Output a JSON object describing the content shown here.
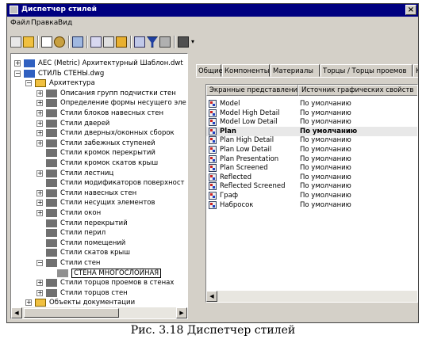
{
  "window": {
    "title": "Диспетчер стилей",
    "close_glyph": "×"
  },
  "menu": [
    "Файл",
    "Правка",
    "Вид"
  ],
  "toolbar_icons": [
    "open-icon",
    "open-folder-icon",
    "copy-icon",
    "paste-icon",
    "properties-icon",
    "purge-icon",
    "edit-icon",
    "paint-icon",
    "sort-icon",
    "filter-icon",
    "toggle-icon",
    "display-icon"
  ],
  "tree": {
    "items": [
      {
        "label": "AEC (Metric) Архитектурный Шаблон.dwt",
        "indent": 0,
        "expander": "+",
        "icon": "drawing-icon"
      },
      {
        "label": "СТИЛЬ СТЕНЫ.dwg",
        "indent": 0,
        "expander": "−",
        "icon": "drawing-icon"
      },
      {
        "label": "Архитектура",
        "indent": 1,
        "expander": "−",
        "icon": "folder-icon"
      },
      {
        "label": "Описания групп подчистки стен",
        "indent": 2,
        "expander": "+",
        "icon": "style-icon"
      },
      {
        "label": "Определение формы несущего эле",
        "indent": 2,
        "expander": "+",
        "icon": "style-icon"
      },
      {
        "label": "Стили блоков навесных стен",
        "indent": 2,
        "expander": "+",
        "icon": "style-icon"
      },
      {
        "label": "Стили дверей",
        "indent": 2,
        "expander": "+",
        "icon": "style-icon"
      },
      {
        "label": "Стили дверных/оконных сборок",
        "indent": 2,
        "expander": "+",
        "icon": "style-icon"
      },
      {
        "label": "Стили забежных ступеней",
        "indent": 2,
        "expander": "+",
        "icon": "style-icon"
      },
      {
        "label": "Стили кромок перекрытий",
        "indent": 2,
        "expander": "",
        "icon": "style-icon"
      },
      {
        "label": "Стили кромок скатов крыш",
        "indent": 2,
        "expander": "",
        "icon": "style-icon"
      },
      {
        "label": "Стили лестниц",
        "indent": 2,
        "expander": "+",
        "icon": "style-icon"
      },
      {
        "label": "Стили модификаторов поверхност",
        "indent": 2,
        "expander": "",
        "icon": "style-icon"
      },
      {
        "label": "Стили навесных стен",
        "indent": 2,
        "expander": "+",
        "icon": "style-icon"
      },
      {
        "label": "Стили несущих элементов",
        "indent": 2,
        "expander": "+",
        "icon": "style-icon"
      },
      {
        "label": "Стили окон",
        "indent": 2,
        "expander": "+",
        "icon": "style-icon"
      },
      {
        "label": "Стили перекрытий",
        "indent": 2,
        "expander": "",
        "icon": "style-icon"
      },
      {
        "label": "Стили перил",
        "indent": 2,
        "expander": "",
        "icon": "style-icon"
      },
      {
        "label": "Стили помещений",
        "indent": 2,
        "expander": "",
        "icon": "style-icon"
      },
      {
        "label": "Стили скатов крыш",
        "indent": 2,
        "expander": "",
        "icon": "style-icon"
      },
      {
        "label": "Стили стен",
        "indent": 2,
        "expander": "−",
        "icon": "style-icon"
      },
      {
        "label": "СТЕНА МНОГОСЛОЙНАЯ",
        "indent": 3,
        "expander": "",
        "icon": "wall-style-icon",
        "editing": true
      },
      {
        "label": "Стили торцов проемов в стенах",
        "indent": 2,
        "expander": "+",
        "icon": "style-icon"
      },
      {
        "label": "Стили торцов стен",
        "indent": 2,
        "expander": "+",
        "icon": "style-icon"
      },
      {
        "label": "Объекты документации",
        "indent": 1,
        "expander": "+",
        "icon": "folder-icon"
      }
    ]
  },
  "tabs": [
    "Общие",
    "Компоненты",
    "Материалы",
    "Торцы / Торцы проемов",
    "К"
  ],
  "list": {
    "columns": [
      "Экранные представления",
      "Источник графических свойств"
    ],
    "rows": [
      {
        "name": "Model",
        "source": "По умолчанию",
        "bold": false
      },
      {
        "name": "Model High Detail",
        "source": "По умолчанию",
        "bold": false
      },
      {
        "name": "Model Low Detail",
        "source": "По умолчанию",
        "bold": false
      },
      {
        "name": "Plan",
        "source": "По умолчанию",
        "bold": true
      },
      {
        "name": "Plan High Detail",
        "source": "По умолчанию",
        "bold": false
      },
      {
        "name": "Plan Low Detail",
        "source": "По умолчанию",
        "bold": false
      },
      {
        "name": "Plan Presentation",
        "source": "По умолчанию",
        "bold": false
      },
      {
        "name": "Plan Screened",
        "source": "По умолчанию",
        "bold": false
      },
      {
        "name": "Reflected",
        "source": "По умолчанию",
        "bold": false
      },
      {
        "name": "Reflected Screened",
        "source": "По умолчанию",
        "bold": false
      },
      {
        "name": "Граф",
        "source": "По умолчанию",
        "bold": false
      },
      {
        "name": "Набросок",
        "source": "По умолчанию",
        "bold": false
      }
    ]
  },
  "caption": "Рис. 3.18 Диспетчер стилей"
}
